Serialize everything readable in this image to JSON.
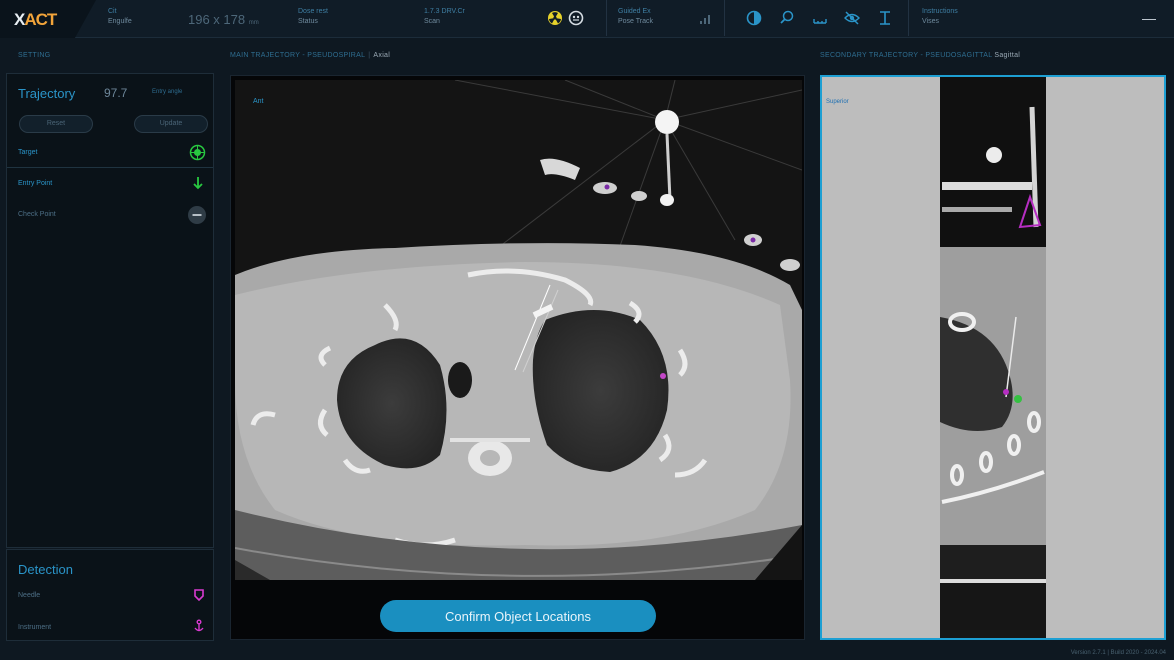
{
  "topbar": {
    "logo": {
      "part1": "X",
      "part2": "ACT"
    },
    "patient": {
      "label": "Cit",
      "value": "Engulfe"
    },
    "dims": {
      "value": "196 x 178",
      "unit": "mm"
    },
    "field3": {
      "label": "Dose rest",
      "value": "Status"
    },
    "field4": {
      "label": "1.7.3 DRV.Cr",
      "value": "Scan"
    },
    "field5": {
      "label": "Guided Ex",
      "value": "Pose Track"
    },
    "field6": {
      "label": "Instructions",
      "value": "Vises"
    },
    "icons": [
      "radiation-icon",
      "robot-icon",
      "brightness-icon",
      "search-icon",
      "measure-icon",
      "eye-off-icon",
      "cursor-icon"
    ],
    "close_label": "—"
  },
  "left_header": "SETTING",
  "main_header": {
    "title": "MAIN TRAJECTORY - PSEUDOSPIRAL",
    "sep": "|",
    "mode": "Axial"
  },
  "secondary_header": {
    "title": "SECONDARY TRAJECTORY - PSEUDOSAGITTAL",
    "mode": "Sagittal"
  },
  "trajectory": {
    "title": "Trajectory",
    "value": "97.7",
    "unit": "Entry angle",
    "reset_label": "Reset",
    "update_label": "Update",
    "rows": [
      {
        "label": "Target",
        "icon": "target-icon",
        "color": "#28c840"
      },
      {
        "label": "Entry Point",
        "icon": "arrow-down-icon",
        "color": "#28c840"
      },
      {
        "label": "Check Point",
        "icon": "minus-circle-icon",
        "color": "#5a6a76"
      }
    ]
  },
  "detection": {
    "title": "Detection",
    "rows": [
      {
        "label": "Needle",
        "icon": "needle-marker-icon",
        "color": "#d93ad1"
      },
      {
        "label": "Instrument",
        "icon": "anchor-marker-icon",
        "color": "#d93ad1"
      }
    ]
  },
  "main_view": {
    "orientation_label": "Ant",
    "confirm_label": "Confirm Object Locations"
  },
  "secondary_view": {
    "orientation_label": "Superior"
  },
  "version": "Version 2.7.1  |  Build 2020 - 2024.04"
}
